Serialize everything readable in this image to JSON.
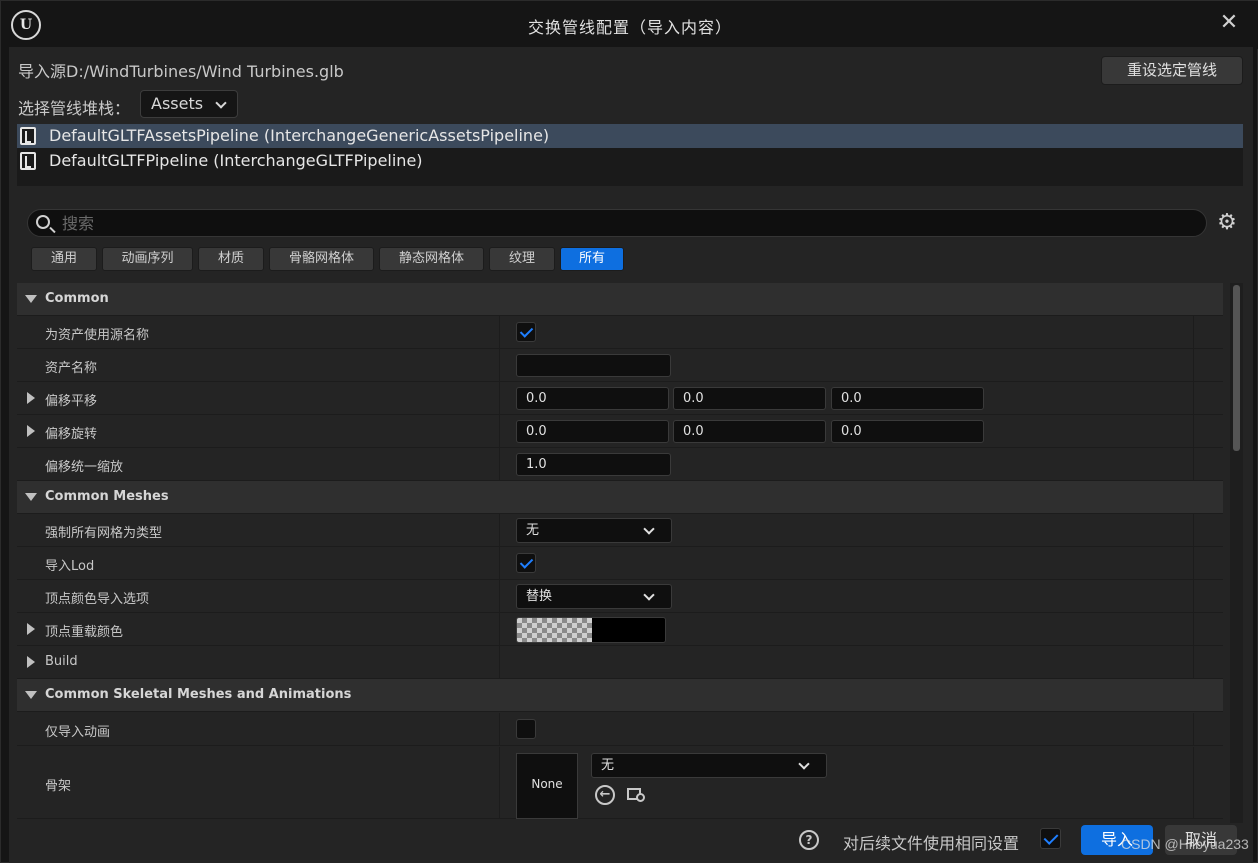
{
  "window": {
    "title": "交换管线配置（导入内容）"
  },
  "source": {
    "text": "导入源D:/WindTurbines/Wind Turbines.glb"
  },
  "reset_button": "重设选定管线",
  "stack": {
    "label": "选择管线堆栈：",
    "value": "Assets"
  },
  "pipelines": [
    {
      "label": "DefaultGLTFAssetsPipeline (InterchangeGenericAssetsPipeline)",
      "selected": true
    },
    {
      "label": "DefaultGLTFPipeline (InterchangeGLTFPipeline)",
      "selected": false
    }
  ],
  "search": {
    "placeholder": "搜索",
    "value": ""
  },
  "filters": [
    {
      "label": "通用",
      "active": false
    },
    {
      "label": "动画序列",
      "active": false
    },
    {
      "label": "材质",
      "active": false
    },
    {
      "label": "骨骼网格体",
      "active": false
    },
    {
      "label": "静态网格体",
      "active": false
    },
    {
      "label": "纹理",
      "active": false
    },
    {
      "label": "所有",
      "active": true
    }
  ],
  "categories": {
    "common": "Common",
    "common_meshes": "Common Meshes",
    "skeletal": "Common Skeletal Meshes and Animations"
  },
  "properties": {
    "use_source_name": {
      "label": "为资产使用源名称",
      "checked": true
    },
    "asset_name": {
      "label": "资产名称",
      "value": ""
    },
    "offset_translation": {
      "label": "偏移平移",
      "x": "0.0",
      "y": "0.0",
      "z": "0.0"
    },
    "offset_rotation": {
      "label": "偏移旋转",
      "x": "0.0",
      "y": "0.0",
      "z": "0.0"
    },
    "offset_scale": {
      "label": "偏移统一缩放",
      "value": "1.0"
    },
    "force_mesh_type": {
      "label": "强制所有网格为类型",
      "value": "无"
    },
    "import_lod": {
      "label": "导入Lod",
      "checked": true
    },
    "vertex_color_option": {
      "label": "顶点颜色导入选项",
      "value": "替换"
    },
    "vertex_color_override": {
      "label": "顶点重载颜色",
      "color": "#000000"
    },
    "build": {
      "label": "Build"
    },
    "import_only_animations": {
      "label": "仅导入动画",
      "checked": false
    },
    "skeleton": {
      "label": "骨架",
      "thumbnail_text": "None",
      "value": "无"
    }
  },
  "footer": {
    "same_settings_label": "对后续文件使用相同设置",
    "same_settings_checked": true,
    "import_label": "导入",
    "cancel_label": "取消"
  },
  "watermark": "CSDN @Hilbyua233",
  "colors": {
    "accent": "#0e6fe0",
    "selected_row": "#3c4a5c",
    "checkmark": "#1f7fff"
  }
}
